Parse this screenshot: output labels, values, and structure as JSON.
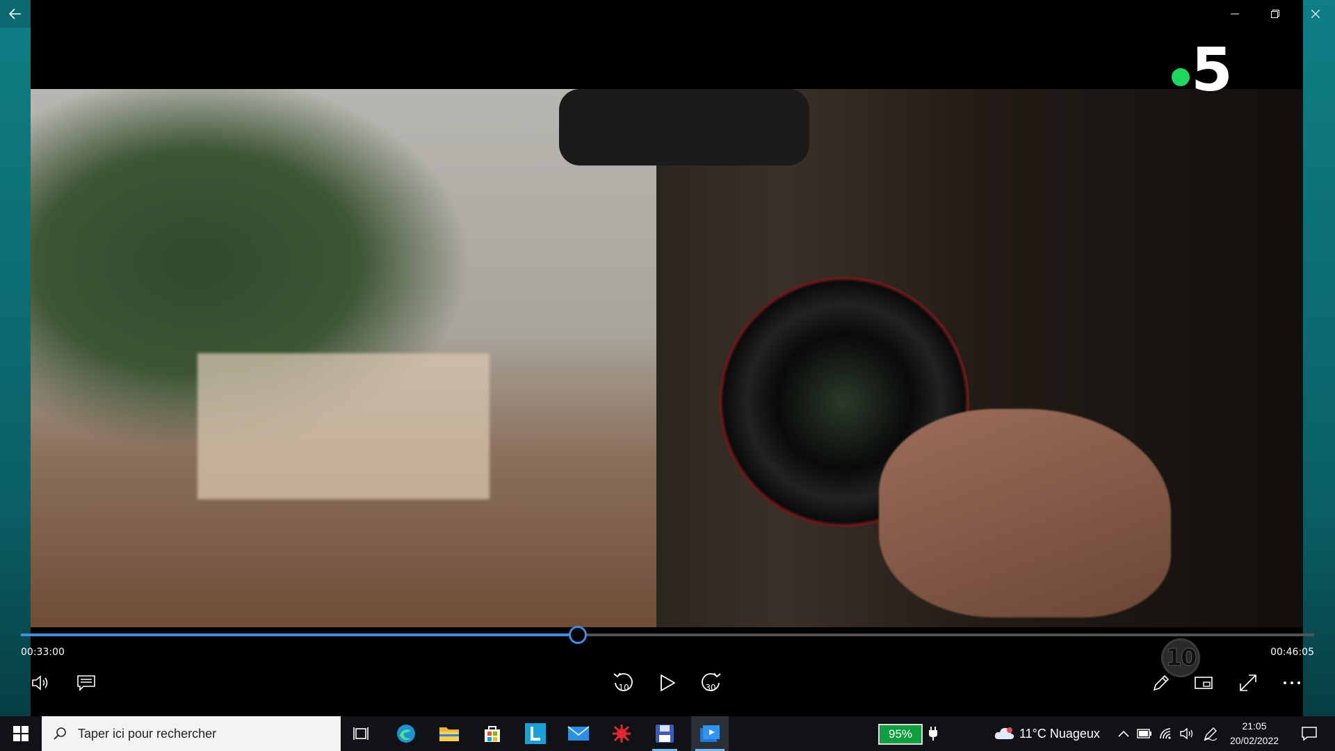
{
  "player": {
    "channel_logo": "5",
    "rating_badge": "10",
    "current_time": "00:33:00",
    "total_time": "00:46:05",
    "progress": 0.43,
    "accent_color": "#3d8fe0",
    "logo_dot_color": "#1ed760",
    "controls": {
      "rewind_label": "10",
      "forward_label": "30"
    }
  },
  "window": {
    "back_icon": "back-arrow-icon",
    "minimize_icon": "minimize-icon",
    "maximize_icon": "restore-icon",
    "close_icon": "close-icon"
  },
  "taskbar": {
    "search_placeholder": "Taper ici pour rechercher",
    "battery_percent": "95%",
    "weather": "11°C  Nuageux",
    "time": "21:05",
    "date": "20/02/2022",
    "apps": [
      "task-view-icon",
      "edge-icon",
      "file-explorer-icon",
      "store-icon",
      "l-app-icon",
      "mail-icon",
      "red-app-icon",
      "save-app-icon",
      "video-player-icon"
    ]
  }
}
